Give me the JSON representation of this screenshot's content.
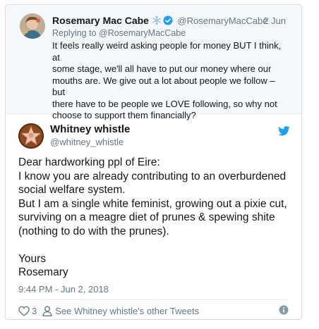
{
  "quoted": {
    "name": "Rosemary Mac Cabe",
    "handle": "@RosemaryMacCabe",
    "date": "2 Jun",
    "replying_to": "Replying to @RosemaryMacCabe",
    "text_lines": [
      "It feels really weird asking people for money BUT I think, at",
      "some stage, we'll all have to put our money where our",
      "mouths are. We give out a lot about people we follow – but",
      "there have to be people we LOVE following, so why not",
      "choose to support them financially?"
    ]
  },
  "tweet": {
    "name": "Whitney whistle",
    "handle": "@whitney_whistle",
    "text_lines": [
      "Dear hardworking ppl of Eire:",
      "I know you are already contributing to an overburdened",
      "social welfare system.",
      "But I am a single white feminist, growing out a pixie cut,",
      "surviving on a meagre diet of prunes & spewing shite",
      "(nothing to do with the prunes).",
      "",
      "Yours",
      "Rosemary"
    ],
    "timestamp": "9:44 PM - Jun 2, 2018",
    "like_count": "3",
    "other_tweets_label": "See Whitney whistle's other Tweets"
  },
  "icons": {
    "verified": "verified-badge-icon",
    "snowflake": "snowflake-icon",
    "twitter_logo": "twitter-bird-icon",
    "like": "heart-icon",
    "profile": "person-icon",
    "info": "info-icon"
  },
  "colors": {
    "twitter_blue": "#1da1f2",
    "text": "#14171a",
    "secondary": "#657786",
    "quoted_bg": "#f5f8fa"
  }
}
